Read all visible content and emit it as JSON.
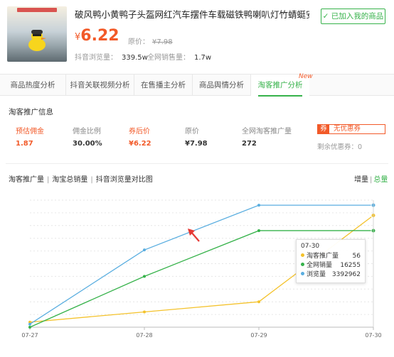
{
  "product": {
    "title": "破风鸭小黄鸭子头盔网红汽车摆件车载磁铁鸭喇叭灯竹蜻蜓安全帽鸭",
    "price_symbol": "¥",
    "price": "6.22",
    "orig_label": "原价：",
    "orig_price": "¥7.98",
    "views_label": "抖音浏览量：",
    "views_value": "339.5w",
    "sales_label": "全网销售量：",
    "sales_value": "1.7w",
    "added_label": "✓ 已加入我的商品"
  },
  "tabs": [
    {
      "label": "商品热度分析"
    },
    {
      "label": "抖音关联视频分析"
    },
    {
      "label": "在售播主分析"
    },
    {
      "label": "商品舆情分析"
    },
    {
      "label": "淘客推广分析"
    }
  ],
  "new_badge": "New",
  "info": {
    "section_title": "淘客推广信息",
    "commission_label": "预估佣金",
    "commission_value": "1.87",
    "ratio_label": "佣金比例",
    "ratio_value": "30.00%",
    "after_label": "券后价",
    "after_value": "¥6.22",
    "orig_label": "原价",
    "orig_value": "¥7.98",
    "promo_label": "全网淘客推广量",
    "promo_value": "272",
    "coupon_tag": "券",
    "coupon_text": "无优惠券",
    "coupon_left": "剩余优惠券：0"
  },
  "chart_header": {
    "title_1": "淘客推广量",
    "title_2": "淘宝总销量",
    "title_3": "抖音浏览量对比图",
    "sep": "|",
    "toggle_inc": "增量",
    "toggle_total": "总量"
  },
  "tooltip": {
    "date": "07-30",
    "rows": [
      {
        "name": "淘客推广量",
        "value": "56",
        "color": "#f4c22b"
      },
      {
        "name": "全网销量",
        "value": "16255",
        "color": "#36b24a"
      },
      {
        "name": "浏览量",
        "value": "3392962",
        "color": "#5aaee0"
      }
    ]
  },
  "chart_data": {
    "type": "line",
    "categories": [
      "07-27",
      "07-28",
      "07-29",
      "07-30"
    ],
    "series": [
      {
        "name": "淘客推广量",
        "color": "#f4c22b",
        "values": [
          0.05,
          0.15,
          0.25,
          1.1
        ]
      },
      {
        "name": "全网销量",
        "color": "#36b24a",
        "values": [
          0.0,
          0.5,
          0.95,
          0.95
        ]
      },
      {
        "name": "浏览量",
        "color": "#5aaee0",
        "values": [
          0.03,
          0.76,
          1.2,
          1.2
        ]
      }
    ],
    "ylim": [
      0,
      1.25
    ],
    "grid": true
  }
}
